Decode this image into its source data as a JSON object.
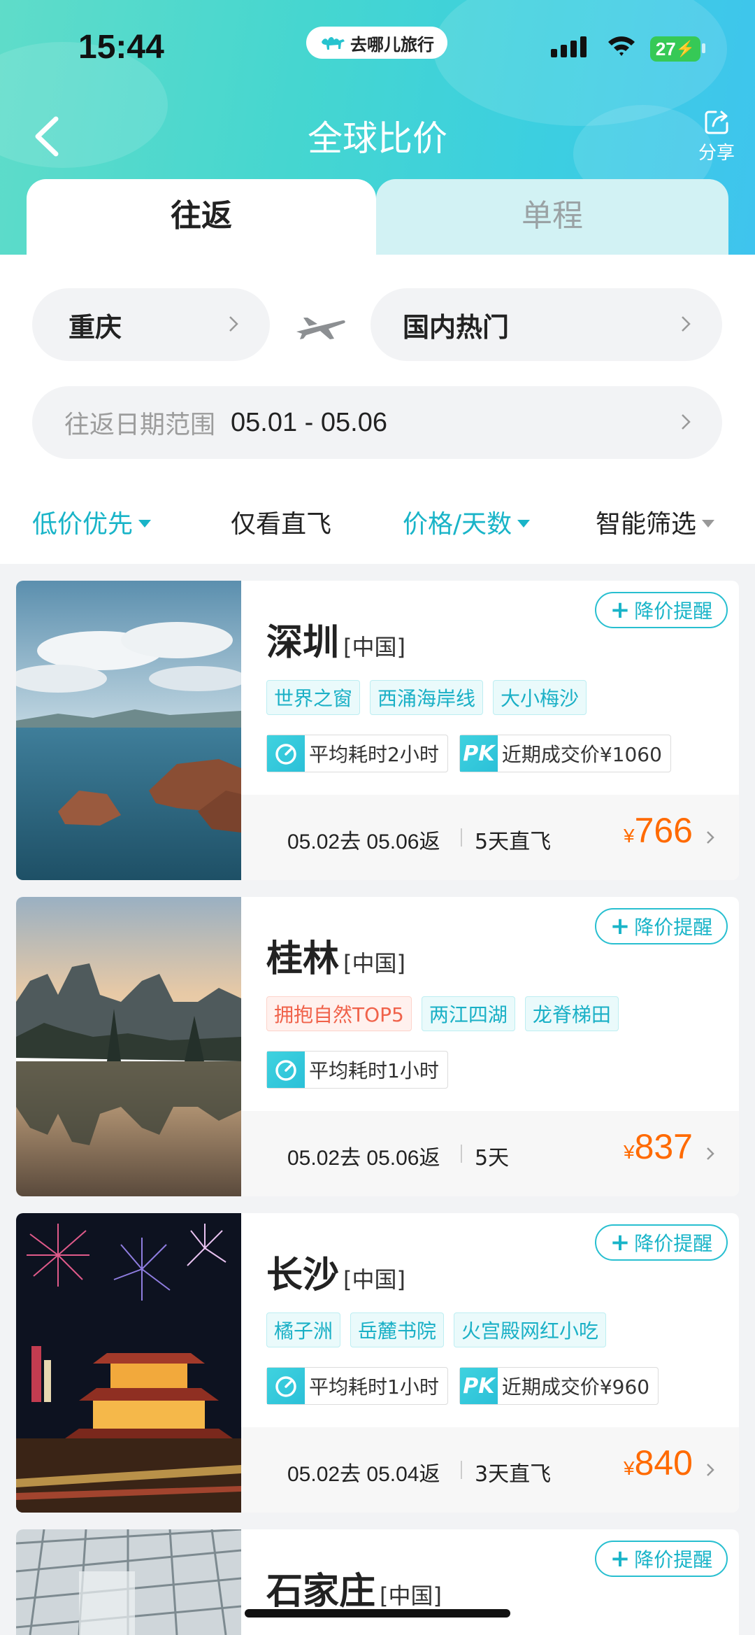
{
  "status_bar": {
    "time": "15:44",
    "brand": "去哪儿旅行",
    "battery": "27"
  },
  "header": {
    "title": "全球比价",
    "share_label": "分享"
  },
  "tabs": [
    {
      "label": "往返",
      "active": true
    },
    {
      "label": "单程",
      "active": false
    }
  ],
  "search": {
    "from": "重庆",
    "to": "国内热门",
    "date_label": "往返日期范围",
    "date_value": "05.01 - 05.06"
  },
  "filters": [
    {
      "label": "低价优先",
      "active": true,
      "dropdown": true
    },
    {
      "label": "仅看直飞",
      "active": false,
      "dropdown": false
    },
    {
      "label": "价格/天数",
      "active": true,
      "dropdown": true
    },
    {
      "label": "智能筛选",
      "active": false,
      "dropdown": true
    }
  ],
  "alert_label": "降价提醒",
  "results": [
    {
      "city": "深圳",
      "country": "[中国]",
      "tags": [
        "世界之窗",
        "西涌海岸线",
        "大小梅沙"
      ],
      "avg_time": "平均耗时2小时",
      "deal": "近期成交价¥1060",
      "dates": "05.02去 05.06返",
      "days": "5天直飞",
      "currency": "¥",
      "price": "766"
    },
    {
      "city": "桂林",
      "country": "[中国]",
      "tags": [
        "拥抱自然TOP5",
        "两江四湖",
        "龙脊梯田"
      ],
      "avg_time": "平均耗时1小时",
      "dates": "05.02去 05.06返",
      "days": "5天",
      "currency": "¥",
      "price": "837"
    },
    {
      "city": "长沙",
      "country": "[中国]",
      "tags": [
        "橘子洲",
        "岳麓书院",
        "火宫殿网红小吃"
      ],
      "avg_time": "平均耗时1小时",
      "deal": "近期成交价¥960",
      "dates": "05.02去 05.04返",
      "days": "3天直飞",
      "currency": "¥",
      "price": "840"
    },
    {
      "city": "石家庄",
      "country": "[中国]"
    }
  ],
  "colors": {
    "accent": "#19b4c8",
    "price": "#ff6a00",
    "hot_tag": "#f0624a"
  }
}
